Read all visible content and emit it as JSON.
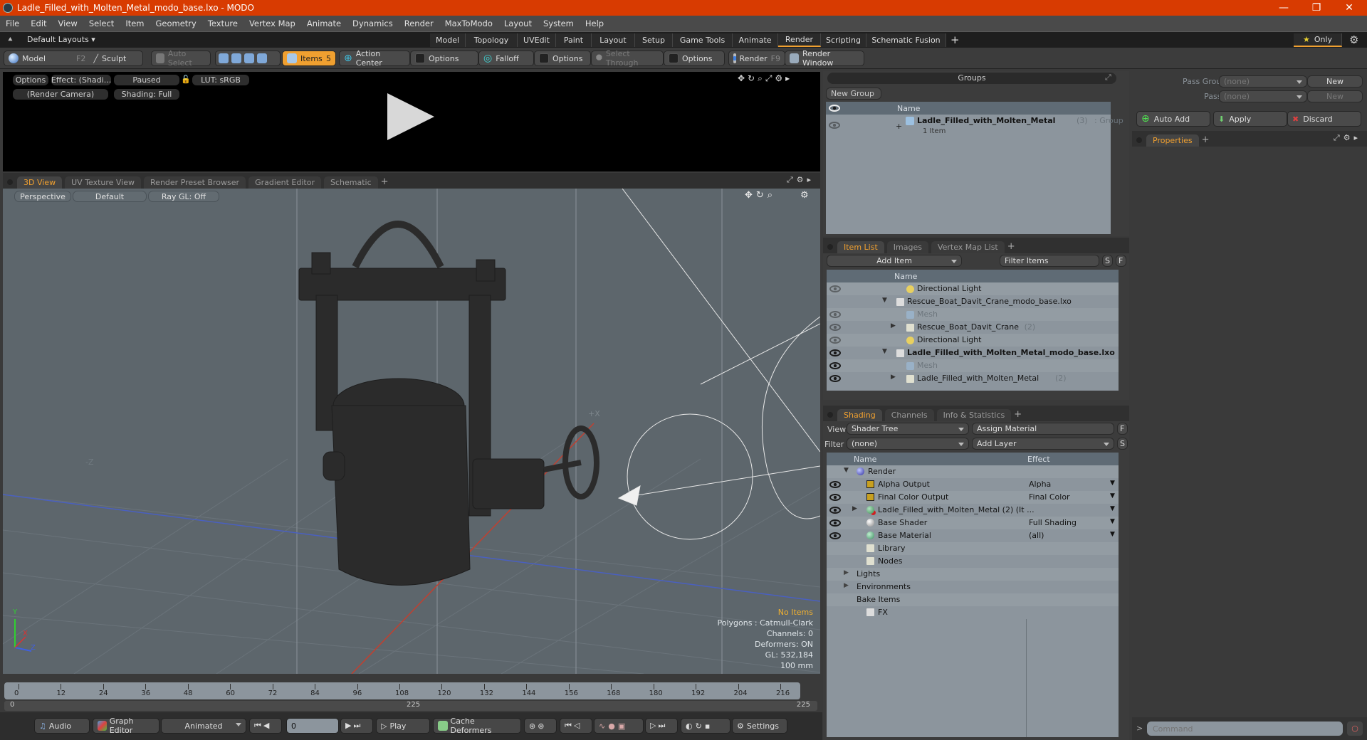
{
  "window": {
    "title": "Ladle_Filled_with_Molten_Metal_modo_base.lxo - MODO",
    "minimize": "—",
    "maximize": "❐",
    "close": "✕"
  },
  "menu": [
    "File",
    "Edit",
    "View",
    "Select",
    "Item",
    "Geometry",
    "Texture",
    "Vertex Map",
    "Animate",
    "Dynamics",
    "Render",
    "MaxToModo",
    "Layout",
    "System",
    "Help"
  ],
  "layouts": {
    "default_label": "Default Layouts ▾",
    "tabs": [
      "Model",
      "Topology",
      "UVEdit",
      "Paint",
      "Layout",
      "Setup",
      "Game Tools",
      "Animate",
      "Render",
      "Scripting",
      "Schematic Fusion"
    ],
    "active_tab": "Render",
    "add": "+",
    "only_label": "Only",
    "star": "★"
  },
  "toolbar": {
    "model": "Model",
    "model_key": "F2",
    "sculpt": "Sculpt",
    "auto_select": "Auto Select",
    "items": "Items",
    "items_count": "5",
    "action_center": "Action Center",
    "options1": "Options",
    "falloff": "Falloff",
    "options2": "Options",
    "select_through": "Select Through",
    "options3": "Options",
    "render": "Render",
    "render_key": "F9",
    "render_window": "Render Window"
  },
  "render_preview": {
    "options": "Options",
    "effect": "Effect: (Shadi...",
    "paused": "Paused",
    "lut": "LUT: sRGB",
    "camera": "(Render Camera)",
    "shading": "Shading: Full"
  },
  "viewport_tabs": [
    "3D View",
    "UV Texture View",
    "Render Preset Browser",
    "Gradient Editor",
    "Schematic"
  ],
  "viewport": {
    "projection": "Perspective",
    "style": "Default",
    "raygl": "Ray GL: Off",
    "axis_label": "+X",
    "neg_label": "-Z",
    "stats": {
      "selection": "No Items",
      "polygons": "Polygons : Catmull-Clark",
      "channels": "Channels: 0",
      "deformers": "Deformers: ON",
      "gl": "GL: 532,184",
      "unit": "100 mm"
    },
    "axes": {
      "x": "X",
      "y": "Y",
      "z": "Z"
    }
  },
  "timeline": {
    "ticks": [
      "0",
      "12",
      "24",
      "36",
      "48",
      "60",
      "72",
      "84",
      "96",
      "108",
      "120",
      "132",
      "144",
      "156",
      "168",
      "180",
      "192",
      "204",
      "216"
    ],
    "range_start": "0",
    "range_mid": "225",
    "range_end": "225"
  },
  "bottom": {
    "audio": "Audio",
    "graph_editor": "Graph Editor",
    "animated": "Animated",
    "frame": "0",
    "play": "Play",
    "cache_deformers": "Cache Deformers",
    "settings": "Settings"
  },
  "groups": {
    "title": "Groups",
    "new_group": "New Group",
    "col_name": "Name",
    "item_name": "Ladle_Filled_with_Molten_Metal",
    "item_count": "(3)",
    "item_type": ": Group",
    "item_sub": "1 Item"
  },
  "item_list": {
    "tabs": [
      "Item List",
      "Images",
      "Vertex Map List"
    ],
    "add_item": "Add Item",
    "filter": "Filter Items",
    "s": "S",
    "f": "F",
    "col_name": "Name",
    "rows": [
      {
        "label": "Directional Light",
        "count": "",
        "indent": 2,
        "eye": "dim",
        "bold": false,
        "dim": false,
        "icon": "light"
      },
      {
        "label": "Rescue_Boat_Davit_Crane_modo_base.lxo",
        "count": "",
        "indent": 1,
        "eye": "none",
        "bold": false,
        "dim": false,
        "icon": "scene"
      },
      {
        "label": "Mesh",
        "count": "",
        "indent": 2,
        "eye": "dim",
        "bold": false,
        "dim": true,
        "icon": "mesh"
      },
      {
        "label": "Rescue_Boat_Davit_Crane",
        "count": "(2)",
        "indent": 2,
        "eye": "dim",
        "bold": false,
        "dim": false,
        "icon": "folder"
      },
      {
        "label": "Directional Light",
        "count": "",
        "indent": 2,
        "eye": "dim",
        "bold": false,
        "dim": false,
        "icon": "light"
      },
      {
        "label": "Ladle_Filled_with_Molten_Metal_modo_base.lxo",
        "count": "",
        "indent": 1,
        "eye": "on",
        "bold": true,
        "dim": false,
        "icon": "scene"
      },
      {
        "label": "Mesh",
        "count": "",
        "indent": 2,
        "eye": "on",
        "bold": false,
        "dim": true,
        "icon": "mesh"
      },
      {
        "label": "Ladle_Filled_with_Molten_Metal",
        "count": "(2)",
        "indent": 2,
        "eye": "on",
        "bold": false,
        "dim": false,
        "icon": "folder"
      }
    ]
  },
  "shading": {
    "tabs": [
      "Shading",
      "Channels",
      "Info & Statistics"
    ],
    "view_label": "View",
    "view_value": "Shader Tree",
    "assign": "Assign Material",
    "f": "F",
    "filter_label": "Filter",
    "filter_value": "(none)",
    "add_layer": "Add Layer",
    "s": "S",
    "col_name": "Name",
    "col_effect": "Effect",
    "rows": [
      {
        "label": "Render",
        "effect": "",
        "eye": false,
        "indent": 0,
        "icon": "sphere-blue"
      },
      {
        "label": "Alpha Output",
        "effect": "Alpha",
        "eye": true,
        "indent": 1,
        "icon": "output"
      },
      {
        "label": "Final Color Output",
        "effect": "Final Color",
        "eye": true,
        "indent": 1,
        "icon": "output"
      },
      {
        "label": "Ladle_Filled_with_Molten_Metal (2) (It ...",
        "effect": "",
        "eye": true,
        "indent": 1,
        "icon": "mat-group"
      },
      {
        "label": "Base Shader",
        "effect": "Full Shading",
        "eye": true,
        "indent": 1,
        "icon": "sphere-white"
      },
      {
        "label": "Base Material",
        "effect": "(all)",
        "eye": true,
        "indent": 1,
        "icon": "sphere-green"
      },
      {
        "label": "Library",
        "effect": "",
        "eye": false,
        "indent": 1,
        "icon": "folder"
      },
      {
        "label": "Nodes",
        "effect": "",
        "eye": false,
        "indent": 1,
        "icon": "folder"
      },
      {
        "label": "Lights",
        "effect": "",
        "eye": false,
        "indent": 0,
        "icon": "none"
      },
      {
        "label": "Environments",
        "effect": "",
        "eye": false,
        "indent": 0,
        "icon": "none"
      },
      {
        "label": "Bake Items",
        "effect": "",
        "eye": false,
        "indent": 0,
        "icon": "none"
      },
      {
        "label": "FX",
        "effect": "",
        "eye": false,
        "indent": 1,
        "icon": "scene"
      }
    ]
  },
  "passes": {
    "pass_groups_label": "Pass Groups",
    "pass_groups_value": "(none)",
    "new1": "New",
    "passes_label": "Passes",
    "passes_value": "(none)",
    "new2": "New",
    "auto_add": "Auto Add",
    "apply": "Apply",
    "discard": "Discard",
    "properties_tab": "Properties"
  },
  "command": {
    "prompt": ">",
    "placeholder": "Command"
  },
  "colors": {
    "title_bar": "#d83b01",
    "accent": "#f0a030",
    "viewport_bg": "#5d666c",
    "panel_list_bg": "#8c959d"
  }
}
